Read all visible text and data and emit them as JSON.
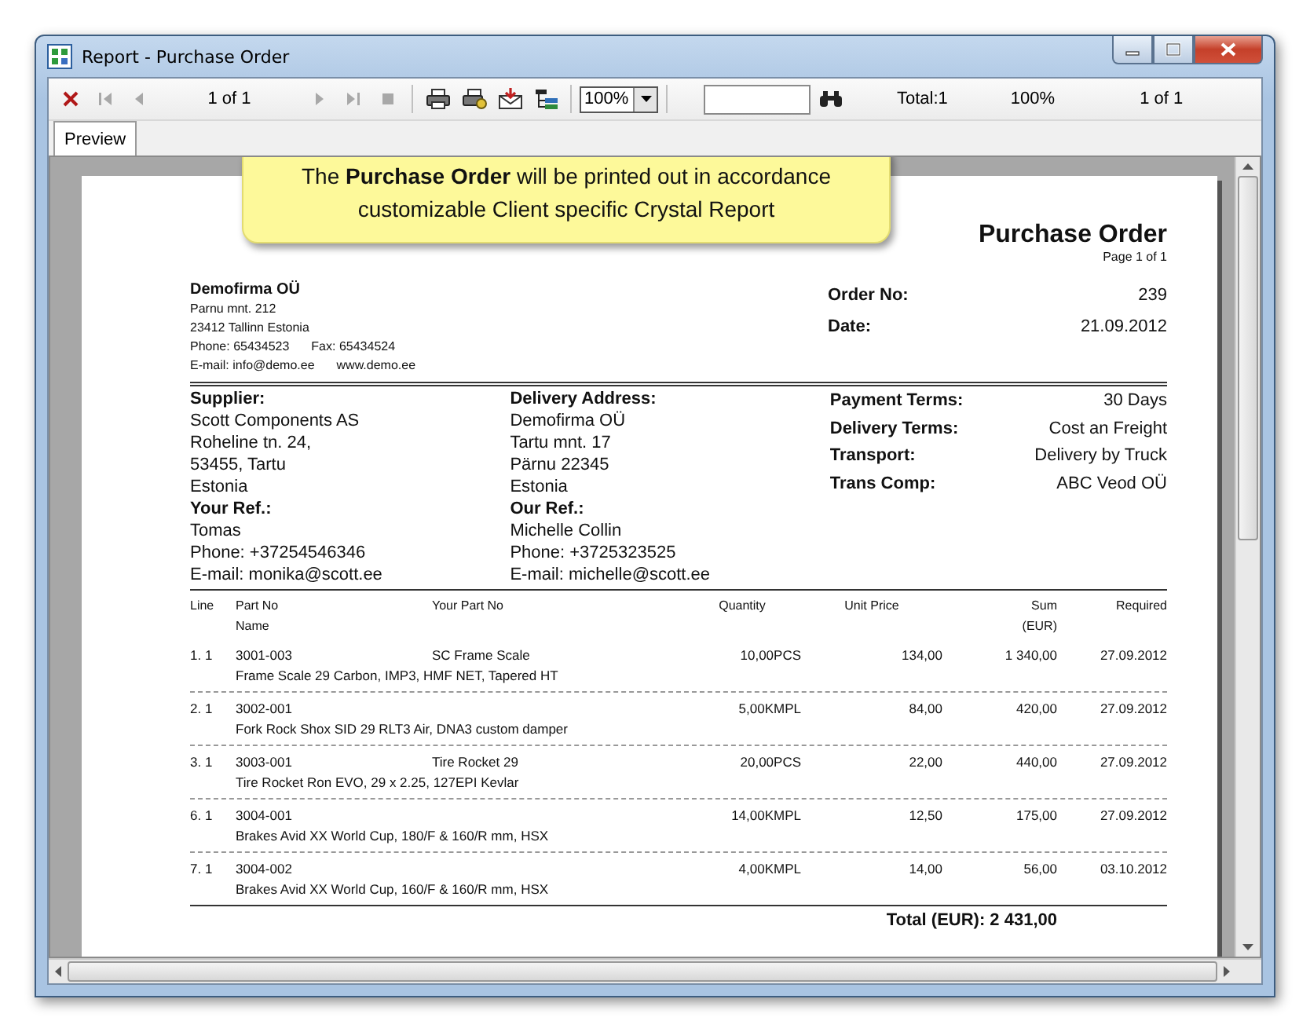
{
  "window": {
    "title": "Report - Purchase Order"
  },
  "toolbar": {
    "nav_start": [
      {
        "kind": "close",
        "disabled": false
      },
      {
        "kind": "first",
        "disabled": true
      },
      {
        "kind": "previous",
        "disabled": true
      }
    ],
    "page_indicator": "1 of 1",
    "nav_end": [
      {
        "kind": "next",
        "disabled": true
      },
      {
        "kind": "last",
        "disabled": true
      },
      {
        "kind": "stop",
        "disabled": true
      }
    ],
    "tools": [
      {
        "kind": "print"
      },
      {
        "kind": "printer-setup"
      },
      {
        "kind": "export"
      },
      {
        "kind": "group-tree"
      }
    ],
    "zoom": "100%",
    "status": {
      "total": "Total:1",
      "zoom": "100%",
      "page": "1 of 1"
    }
  },
  "tabs": [
    {
      "label": "Preview",
      "selected": true
    }
  ],
  "callout": {
    "text": "The **Purchase Order** will be printed out in accordance customizable Client specific Crystal Report"
  },
  "report": {
    "title": "Purchase Order",
    "page_label": "Page 1 of 1",
    "company": {
      "name": "Demofirma OÜ",
      "lines": [
        "Parnu mnt. 212",
        "23412 Tallinn Estonia"
      ],
      "contacts": [
        {
          "left": "Phone: 65434523",
          "right": "Fax: 65434524"
        },
        {
          "left": "E-mail: info@demo.ee",
          "right": "www.demo.ee"
        }
      ]
    },
    "order_info": [
      {
        "label": "Order No:",
        "value": "239"
      },
      {
        "label": "Date:",
        "value": "21.09.2012"
      }
    ],
    "parties": [
      {
        "heading": "Supplier:",
        "lines": [
          "Scott Components AS",
          "Roheline tn. 24,",
          "53455, Tartu",
          "Estonia"
        ],
        "ref_heading": "Your Ref.:",
        "ref_lines": [
          "Tomas",
          "Phone: +37254546346",
          "E-mail: monika@scott.ee"
        ]
      },
      {
        "heading": "Delivery Address:",
        "lines": [
          "Demofirma OÜ",
          "Tartu mnt. 17",
          "Pärnu 22345",
          "Estonia"
        ],
        "ref_heading": "Our Ref.:",
        "ref_lines": [
          "Michelle Collin",
          "Phone: +3725323525",
          "E-mail: michelle@scott.ee"
        ]
      }
    ],
    "terms": [
      {
        "label": "Payment Terms:",
        "value": "30 Days"
      },
      {
        "label": "Delivery Terms:",
        "value": "Cost an Freight"
      },
      {
        "label": "Transport:",
        "value": "Delivery by Truck"
      },
      {
        "label": "Trans Comp:",
        "value": "ABC Veod OÜ"
      }
    ],
    "table": {
      "columns": [
        {
          "label": "Line"
        },
        {
          "label": "Part No",
          "sub": "Name"
        },
        {
          "label": "Your Part No"
        },
        {
          "label": "Quantity"
        },
        {
          "label": "Unit Price"
        },
        {
          "label": "Sum",
          "sub": "(EUR)"
        },
        {
          "label": "Required"
        }
      ],
      "rows": [
        {
          "line": "1. 1",
          "part_no": "3001-003",
          "your_part_no": "SC Frame Scale",
          "quantity": "10,00PCS",
          "unit_price": "134,00",
          "sum": "1 340,00",
          "required": "27.09.2012",
          "name": "Frame Scale 29 Carbon, IMP3, HMF NET, Tapered HT"
        },
        {
          "line": "2. 1",
          "part_no": "3002-001",
          "quantity": "5,00KMPL",
          "unit_price": "84,00",
          "sum": "420,00",
          "required": "27.09.2012",
          "name": "Fork Rock Shox SID 29 RLT3 Air, DNA3 custom damper"
        },
        {
          "line": "3. 1",
          "part_no": "3003-001",
          "your_part_no": "Tire Rocket 29",
          "quantity": "20,00PCS",
          "unit_price": "22,00",
          "sum": "440,00",
          "required": "27.09.2012",
          "name": "Tire Rocket Ron EVO, 29 x 2.25, 127EPI Kevlar"
        },
        {
          "line": "6. 1",
          "part_no": "3004-001",
          "quantity": "14,00KMPL",
          "unit_price": "12,50",
          "sum": "175,00",
          "required": "27.09.2012",
          "name": "Brakes Avid XX World Cup, 180/F & 160/R mm, HSX"
        },
        {
          "line": "7. 1",
          "part_no": "3004-002",
          "quantity": "4,00KMPL",
          "unit_price": "14,00",
          "sum": "56,00",
          "required": "03.10.2012",
          "name": "Brakes Avid XX World Cup, 160/F & 160/R mm, HSX"
        }
      ]
    },
    "total": {
      "label": "Total (EUR):",
      "value": "2 431,00"
    }
  }
}
